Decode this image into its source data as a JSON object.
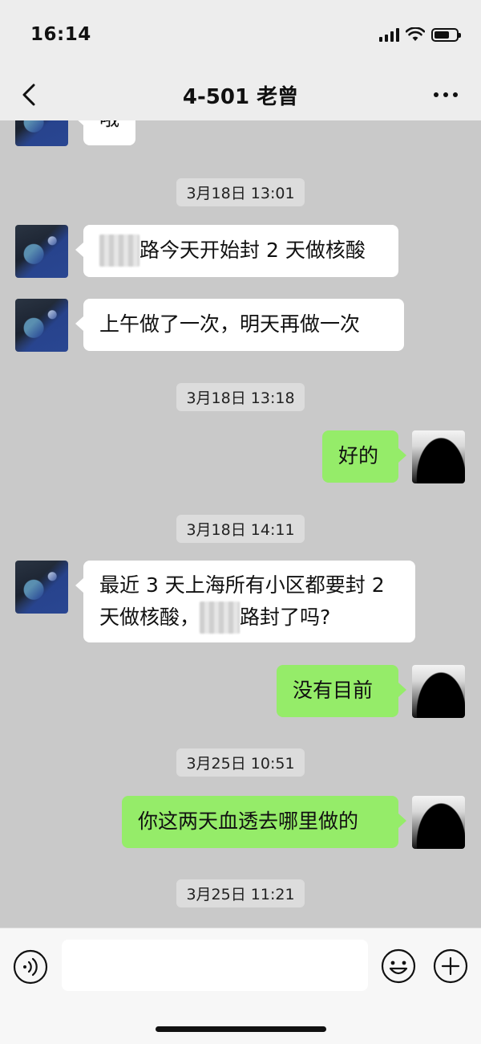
{
  "status_bar": {
    "time": "16:14"
  },
  "nav": {
    "title": "4-501 老曾"
  },
  "messages": [
    {
      "type": "text",
      "side": "left",
      "text": "哦"
    },
    {
      "type": "time",
      "text": "3月18日 13:01"
    },
    {
      "type": "text",
      "side": "left",
      "redacted": "环龙",
      "text": "路今天开始封 2 天做核酸"
    },
    {
      "type": "text",
      "side": "left",
      "text": "上午做了一次，明天再做一次"
    },
    {
      "type": "time",
      "text": "3月18日 13:18"
    },
    {
      "type": "text",
      "side": "right",
      "text": "好的"
    },
    {
      "type": "time",
      "text": "3月18日 14:11"
    },
    {
      "type": "text",
      "side": "left",
      "line1": "最近 3 天上海所有小区都要封 2",
      "line2_prefix": "天做核酸，",
      "redacted": "乳山",
      "line2_suffix": "路封了吗?"
    },
    {
      "type": "text",
      "side": "right",
      "text": "没有目前"
    },
    {
      "type": "time",
      "text": "3月25日 10:51"
    },
    {
      "type": "text",
      "side": "right",
      "text": "你这两天血透去哪里做的"
    },
    {
      "type": "time",
      "text": "3月25日 11:21"
    }
  ],
  "input": {
    "value": ""
  }
}
